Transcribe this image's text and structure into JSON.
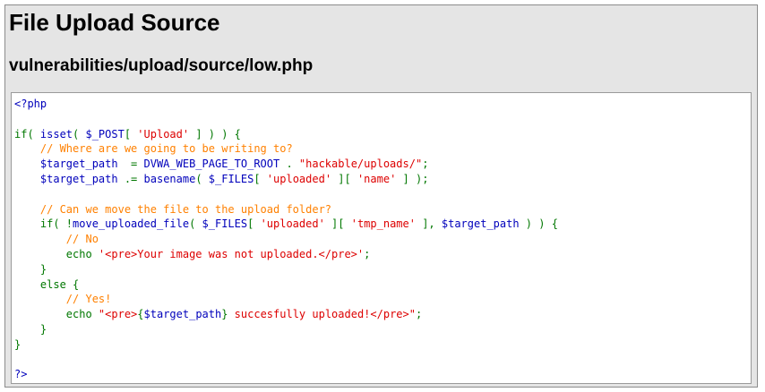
{
  "page": {
    "title": "File Upload Source",
    "source_path": "vulnerabilities/upload/source/low.php"
  },
  "colors": {
    "default": "#0000bb",
    "keyword": "#007700",
    "string": "#dd0000",
    "comment": "#ff8000",
    "background": "#e5e5e5",
    "code_background": "#ffffff"
  },
  "code": {
    "lines": [
      [
        [
          "default",
          "<?php"
        ]
      ],
      [],
      [
        [
          "keyword",
          "if( "
        ],
        [
          "default",
          "isset"
        ],
        [
          "keyword",
          "( "
        ],
        [
          "default",
          "$_POST"
        ],
        [
          "keyword",
          "[ "
        ],
        [
          "string",
          "'Upload'"
        ],
        [
          "keyword",
          " ] ) ) {"
        ]
      ],
      [
        [
          "keyword",
          "    "
        ],
        [
          "comment",
          "// Where are we going to be writing to?"
        ]
      ],
      [
        [
          "default",
          "    $target_path  "
        ],
        [
          "keyword",
          "= "
        ],
        [
          "default",
          "DVWA_WEB_PAGE_TO_ROOT "
        ],
        [
          "keyword",
          ". "
        ],
        [
          "string",
          "\"hackable/uploads/\""
        ],
        [
          "keyword",
          ";"
        ]
      ],
      [
        [
          "default",
          "    $target_path "
        ],
        [
          "keyword",
          ".= "
        ],
        [
          "default",
          "basename"
        ],
        [
          "keyword",
          "( "
        ],
        [
          "default",
          "$_FILES"
        ],
        [
          "keyword",
          "[ "
        ],
        [
          "string",
          "'uploaded'"
        ],
        [
          "keyword",
          " ][ "
        ],
        [
          "string",
          "'name'"
        ],
        [
          "keyword",
          " ] );"
        ]
      ],
      [],
      [
        [
          "keyword",
          "    "
        ],
        [
          "comment",
          "// Can we move the file to the upload folder?"
        ]
      ],
      [
        [
          "keyword",
          "    if( !"
        ],
        [
          "default",
          "move_uploaded_file"
        ],
        [
          "keyword",
          "( "
        ],
        [
          "default",
          "$_FILES"
        ],
        [
          "keyword",
          "[ "
        ],
        [
          "string",
          "'uploaded'"
        ],
        [
          "keyword",
          " ][ "
        ],
        [
          "string",
          "'tmp_name'"
        ],
        [
          "keyword",
          " ], "
        ],
        [
          "default",
          "$target_path"
        ],
        [
          "keyword",
          " ) ) {"
        ]
      ],
      [
        [
          "keyword",
          "        "
        ],
        [
          "comment",
          "// No"
        ]
      ],
      [
        [
          "keyword",
          "        echo "
        ],
        [
          "string",
          "'<pre>Your image was not uploaded.</pre>'"
        ],
        [
          "keyword",
          ";"
        ]
      ],
      [
        [
          "keyword",
          "    }"
        ]
      ],
      [
        [
          "keyword",
          "    else {"
        ]
      ],
      [
        [
          "keyword",
          "        "
        ],
        [
          "comment",
          "// Yes!"
        ]
      ],
      [
        [
          "keyword",
          "        echo "
        ],
        [
          "string",
          "\"<pre>"
        ],
        [
          "keyword",
          "{"
        ],
        [
          "default",
          "$target_path"
        ],
        [
          "keyword",
          "}"
        ],
        [
          "string",
          " succesfully uploaded!</pre>\""
        ],
        [
          "keyword",
          ";"
        ]
      ],
      [
        [
          "keyword",
          "    }"
        ]
      ],
      [
        [
          "keyword",
          "}"
        ]
      ],
      [],
      [
        [
          "default",
          "?>"
        ]
      ]
    ]
  }
}
